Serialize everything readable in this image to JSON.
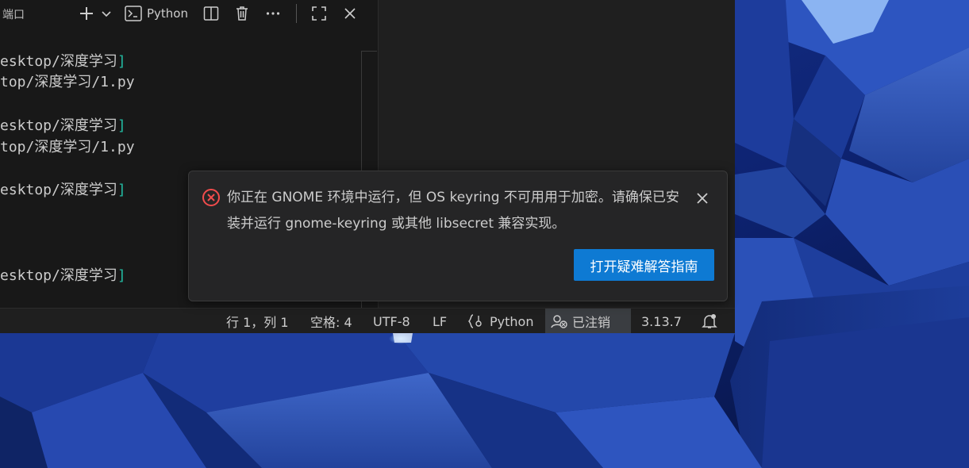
{
  "panel": {
    "title": "端口",
    "terminal_profile_label": "Python",
    "icons": [
      "add-icon",
      "chevron-down-icon",
      "terminal-icon",
      "split-icon",
      "trash-icon",
      "more-icon",
      "maximize-icon",
      "close-icon"
    ]
  },
  "terminal": {
    "lines": [
      {
        "text": "esktop/深度学习",
        "bracket": "]"
      },
      {
        "text": "top/深度学习/1.py",
        "bracket": ""
      },
      {
        "text": "esktop/深度学习",
        "bracket": "]"
      },
      {
        "text": "top/深度学习/1.py",
        "bracket": ""
      },
      {
        "text": "esktop/深度学习",
        "bracket": "]"
      },
      {
        "text": "esktop/深度学习",
        "bracket": "]"
      }
    ]
  },
  "notification": {
    "message": "你正在 GNOME 环境中运行，但 OS keyring 不可用用于加密。请确保已安装并运行 gnome-keyring 或其他 libsecret 兼容实现。",
    "action_label": "打开疑难解答指南",
    "severity_icon": "error-icon",
    "error_color": "#f14c4c",
    "button_color": "#0e7ad3"
  },
  "statusbar": {
    "cursor_position": "行 1，列 1",
    "indentation": "空格: 4",
    "encoding": "UTF-8",
    "line_ending": "LF",
    "language": "Python",
    "account_status": "已注销",
    "interpreter_version": "3.13.7",
    "icons": [
      "braces-icon",
      "account-icon",
      "bell-icon"
    ]
  }
}
